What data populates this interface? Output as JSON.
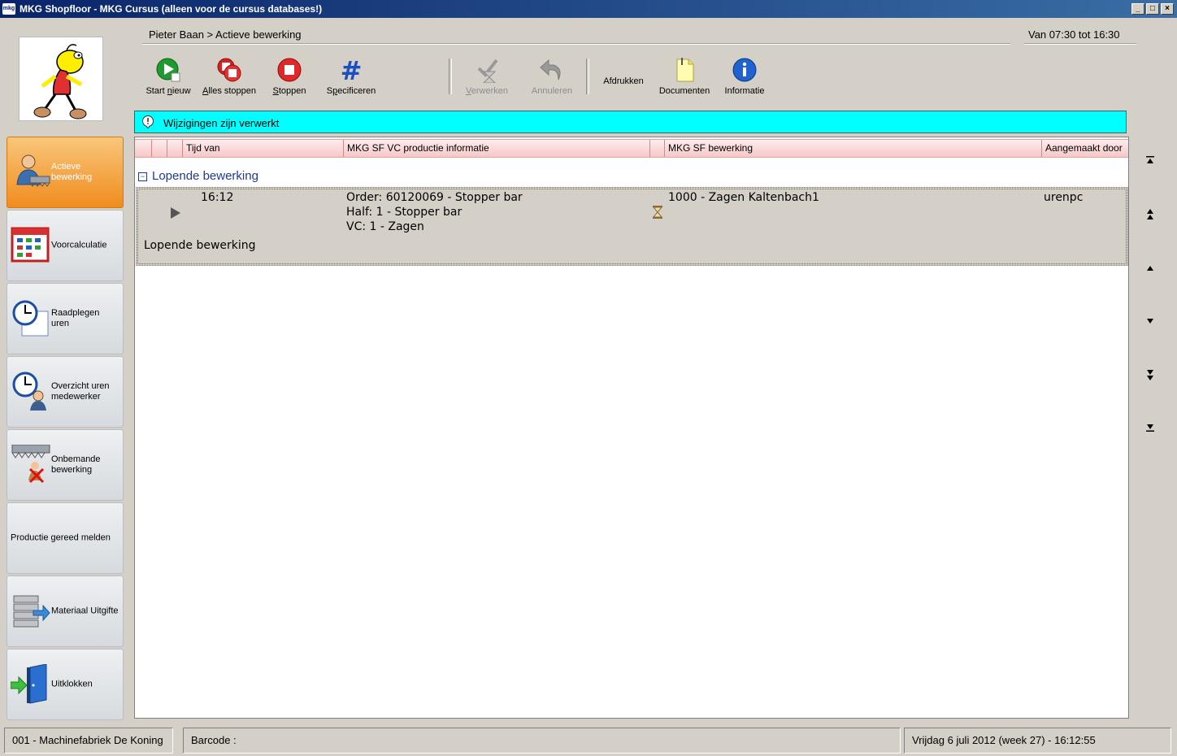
{
  "window": {
    "title": "MKG Shopfloor - MKG Cursus (alleen voor de cursus databases!)",
    "icon_text": "mkg"
  },
  "breadcrumb": "Pieter Baan > Actieve bewerking",
  "time_range": "Van 07:30 tot 16:30",
  "toolbar": {
    "start_nieuw": {
      "pre": "Start ",
      "u": "n",
      "post": "ieuw"
    },
    "alles_stoppen": {
      "pre": "",
      "u": "A",
      "post": "lles stoppen"
    },
    "stoppen": {
      "pre": "",
      "u": "S",
      "post": "toppen"
    },
    "specificeren": {
      "pre": "S",
      "u": "p",
      "post": "ecificeren"
    },
    "verwerken": {
      "pre": "",
      "u": "V",
      "post": "erwerken"
    },
    "annuleren": "Annuleren",
    "afdrukken": "Afdrukken",
    "documenten": "Documenten",
    "informatie": "Informatie"
  },
  "notice": "Wijzigingen zijn verwerkt",
  "grid": {
    "columns": [
      "Tijd van",
      "MKG SF VC productie informatie",
      "MKG SF bewerking",
      "Aangemaakt door"
    ],
    "group_label": "Lopende bewerking",
    "row": {
      "tijd_van": "16:12",
      "info_order": "Order: 60120069 - Stopper bar",
      "info_half": "Half: 1 - Stopper bar",
      "info_vc": "VC: 1 - Zagen",
      "bewerking": "1000 - Zagen Kaltenbach1",
      "aangemaakt_door": "urenpc",
      "status_text": "Lopende bewerking"
    }
  },
  "sidebar": {
    "items": [
      {
        "label": "Actieve bewerking",
        "icon": "worker-saw-icon"
      },
      {
        "label": "Voorcalculatie",
        "icon": "calendar-grid-icon"
      },
      {
        "label": "Raadplegen uren",
        "icon": "clock-document-icon"
      },
      {
        "label": "Overzicht uren medewerker",
        "icon": "clock-person-icon"
      },
      {
        "label": "Onbemande bewerking",
        "icon": "saw-crossed-person-icon"
      },
      {
        "label": "Productie gereed melden",
        "icon": ""
      },
      {
        "label": "Materiaal Uitgifte",
        "icon": "stacked-material-icon"
      },
      {
        "label": "Uitklokken",
        "icon": "exit-door-icon"
      }
    ]
  },
  "status_bar": {
    "company": "001 - Machinefabriek De Koning",
    "barcode": "Barcode :",
    "datetime": "Vrijdag 6 juli 2012 (week 27)  -  16:12:55"
  }
}
